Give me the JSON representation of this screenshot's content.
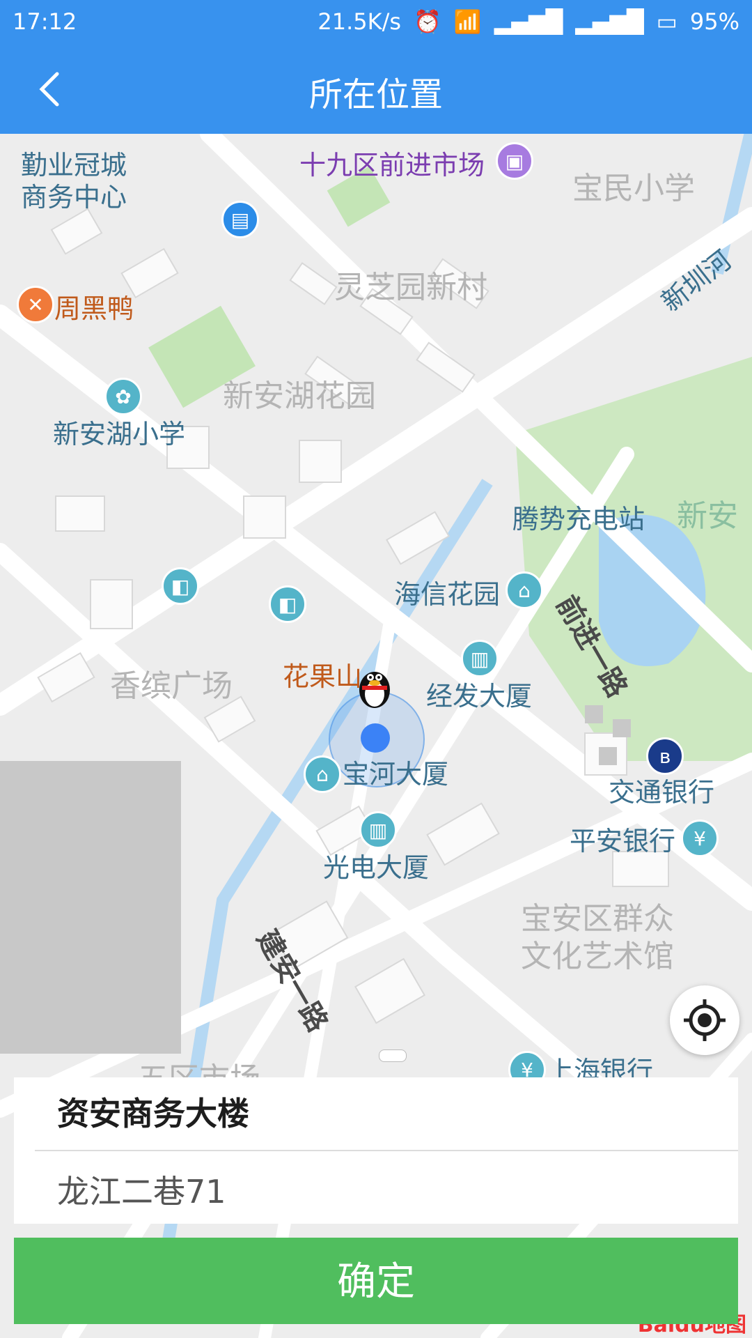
{
  "status_bar": {
    "time": "17:12",
    "speed": "21.5K/s",
    "battery": "95%",
    "icons": [
      "alarm-icon",
      "wifi-icon",
      "signal-icon",
      "signal-icon",
      "battery-icon"
    ]
  },
  "header": {
    "title": "所在位置",
    "back_icon": "chevron-left-icon"
  },
  "map": {
    "labels": {
      "qinye": "勤业冠城\n商务中心",
      "shijiuqu": "十九区前进市场",
      "baomin": "宝民小学",
      "lingzhi": "灵芝园新村",
      "zhouheiya": "周黑鸭",
      "xinhu": "新圳河",
      "xinan_huayuan": "新安湖花园",
      "xinan_xiaoxue": "新安湖小学",
      "tengshi": "腾势充电站",
      "xinan2": "新安",
      "haixin": "海信花园",
      "qianjin": "前进一路",
      "huaguoshan": "花果山",
      "jingfa": "经发大厦",
      "xiangbin": "香缤广场",
      "baohe": "宝河大厦",
      "jiaotong": "交通银行",
      "pingan": "平安银行",
      "guangdian": "光电大厦",
      "jianan": "建安一路",
      "qunzhong": "宝安区群众\n文化艺术馆",
      "shanghai": "上海银行",
      "wuqu": "五区市场"
    }
  },
  "selected_place": {
    "name": "资安商务大楼",
    "address": "龙江二巷71"
  },
  "actions": {
    "confirm": "确定",
    "locate_icon": "locate-crosshair-icon"
  },
  "attribution": "Baidu地图",
  "colors": {
    "header": "#3892ee",
    "confirm": "#50be5e",
    "location_dot": "#3b82f6"
  }
}
